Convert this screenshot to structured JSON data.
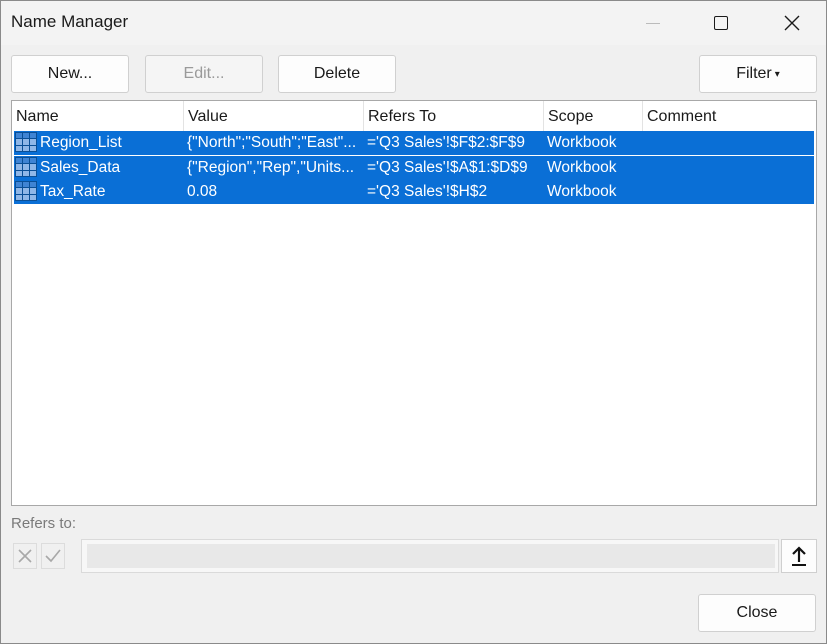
{
  "window": {
    "title": "Name Manager"
  },
  "toolbar": {
    "new_label": "New...",
    "edit_label": "Edit...",
    "delete_label": "Delete",
    "filter_label": "Filter",
    "filter_arrow": "▾"
  },
  "table": {
    "columns": [
      "Name",
      "Value",
      "Refers To",
      "Scope",
      "Comment"
    ],
    "rows": [
      {
        "name": "Region_List",
        "value": "{\"North\";\"South\";\"East\"...",
        "refers_to": "='Q3 Sales'!$F$2:$F$9",
        "scope": "Workbook",
        "comment": ""
      },
      {
        "name": "Sales_Data",
        "value": "{\"Region\",\"Rep\",\"Units...",
        "refers_to": "='Q3 Sales'!$A$1:$D$9",
        "scope": "Workbook",
        "comment": ""
      },
      {
        "name": "Tax_Rate",
        "value": "0.08",
        "refers_to": "='Q3 Sales'!$H$2",
        "scope": "Workbook",
        "comment": ""
      }
    ],
    "selection_color": "#0a6fd6",
    "row_icon": "named-range-table-icon"
  },
  "refers_to": {
    "label": "Refers to:",
    "value": ""
  },
  "footer": {
    "close_label": "Close"
  }
}
